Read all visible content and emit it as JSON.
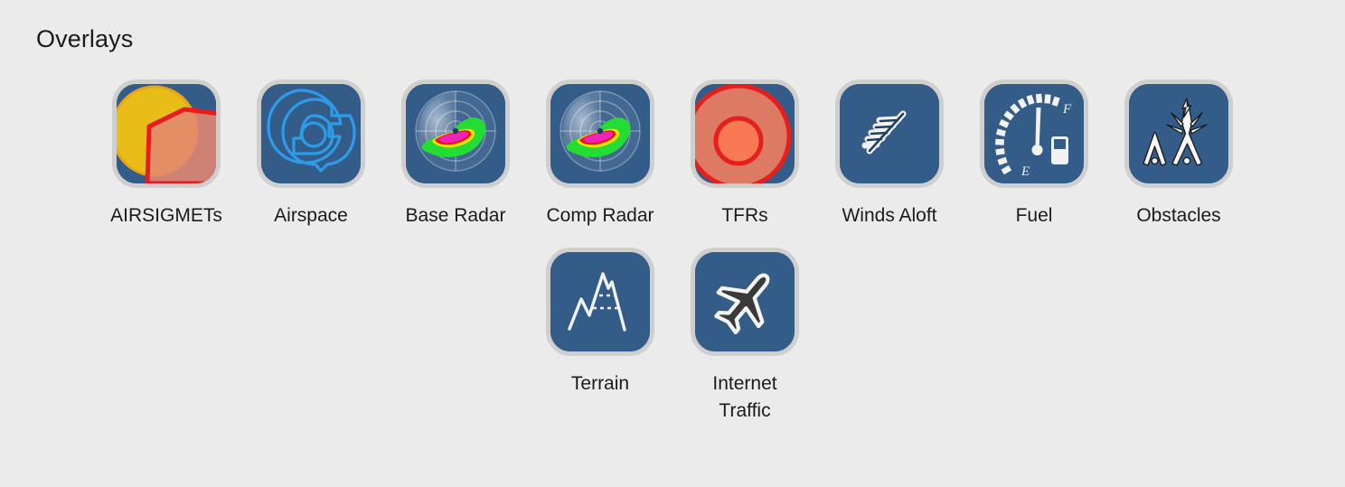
{
  "page": {
    "title": "Overlays",
    "background_color": "#ebebeb",
    "icon_background_color": "#335c89",
    "icon_frame_color": "#cfcfcf",
    "text_color": "#1b1b1b"
  },
  "overlays": {
    "row1": [
      {
        "id": "airsigmets",
        "label": "AIRSIGMETs",
        "icon": "airsigmet-polygon-icon"
      },
      {
        "id": "airspace",
        "label": "Airspace",
        "icon": "airspace-rings-icon"
      },
      {
        "id": "base-radar",
        "label": "Base Radar",
        "icon": "radar-sweep-icon"
      },
      {
        "id": "comp-radar",
        "label": "Comp Radar",
        "icon": "radar-sweep-icon"
      },
      {
        "id": "tfrs",
        "label": "TFRs",
        "icon": "tfr-circles-icon"
      },
      {
        "id": "winds-aloft",
        "label": "Winds Aloft",
        "icon": "wind-barb-icon"
      },
      {
        "id": "fuel",
        "label": "Fuel",
        "icon": "fuel-gauge-icon"
      },
      {
        "id": "obstacles",
        "label": "Obstacles",
        "icon": "obstacle-towers-icon"
      }
    ],
    "row2": [
      {
        "id": "terrain",
        "label": "Terrain",
        "icon": "mountain-profile-icon"
      },
      {
        "id": "internet-traffic",
        "label": "Internet Traffic",
        "icon": "airplane-icon"
      }
    ]
  },
  "palette": {
    "airsigmet_yellow": "#e8bd17",
    "airsigmet_salmon": "#e28872",
    "airsigmet_red": "#e81c1c",
    "airspace_line": "#2e9be8",
    "radar_green": "#22dd33",
    "radar_yellow": "#ffe000",
    "radar_magenta": "#ee22bb",
    "radar_red": "#ee1111",
    "tfr_outer": "#dd7a63",
    "tfr_inner": "#f97a52",
    "tfr_ring": "#e61e1e",
    "icon_white": "#f2f2f2",
    "plane_dark": "#3a3a3a"
  }
}
